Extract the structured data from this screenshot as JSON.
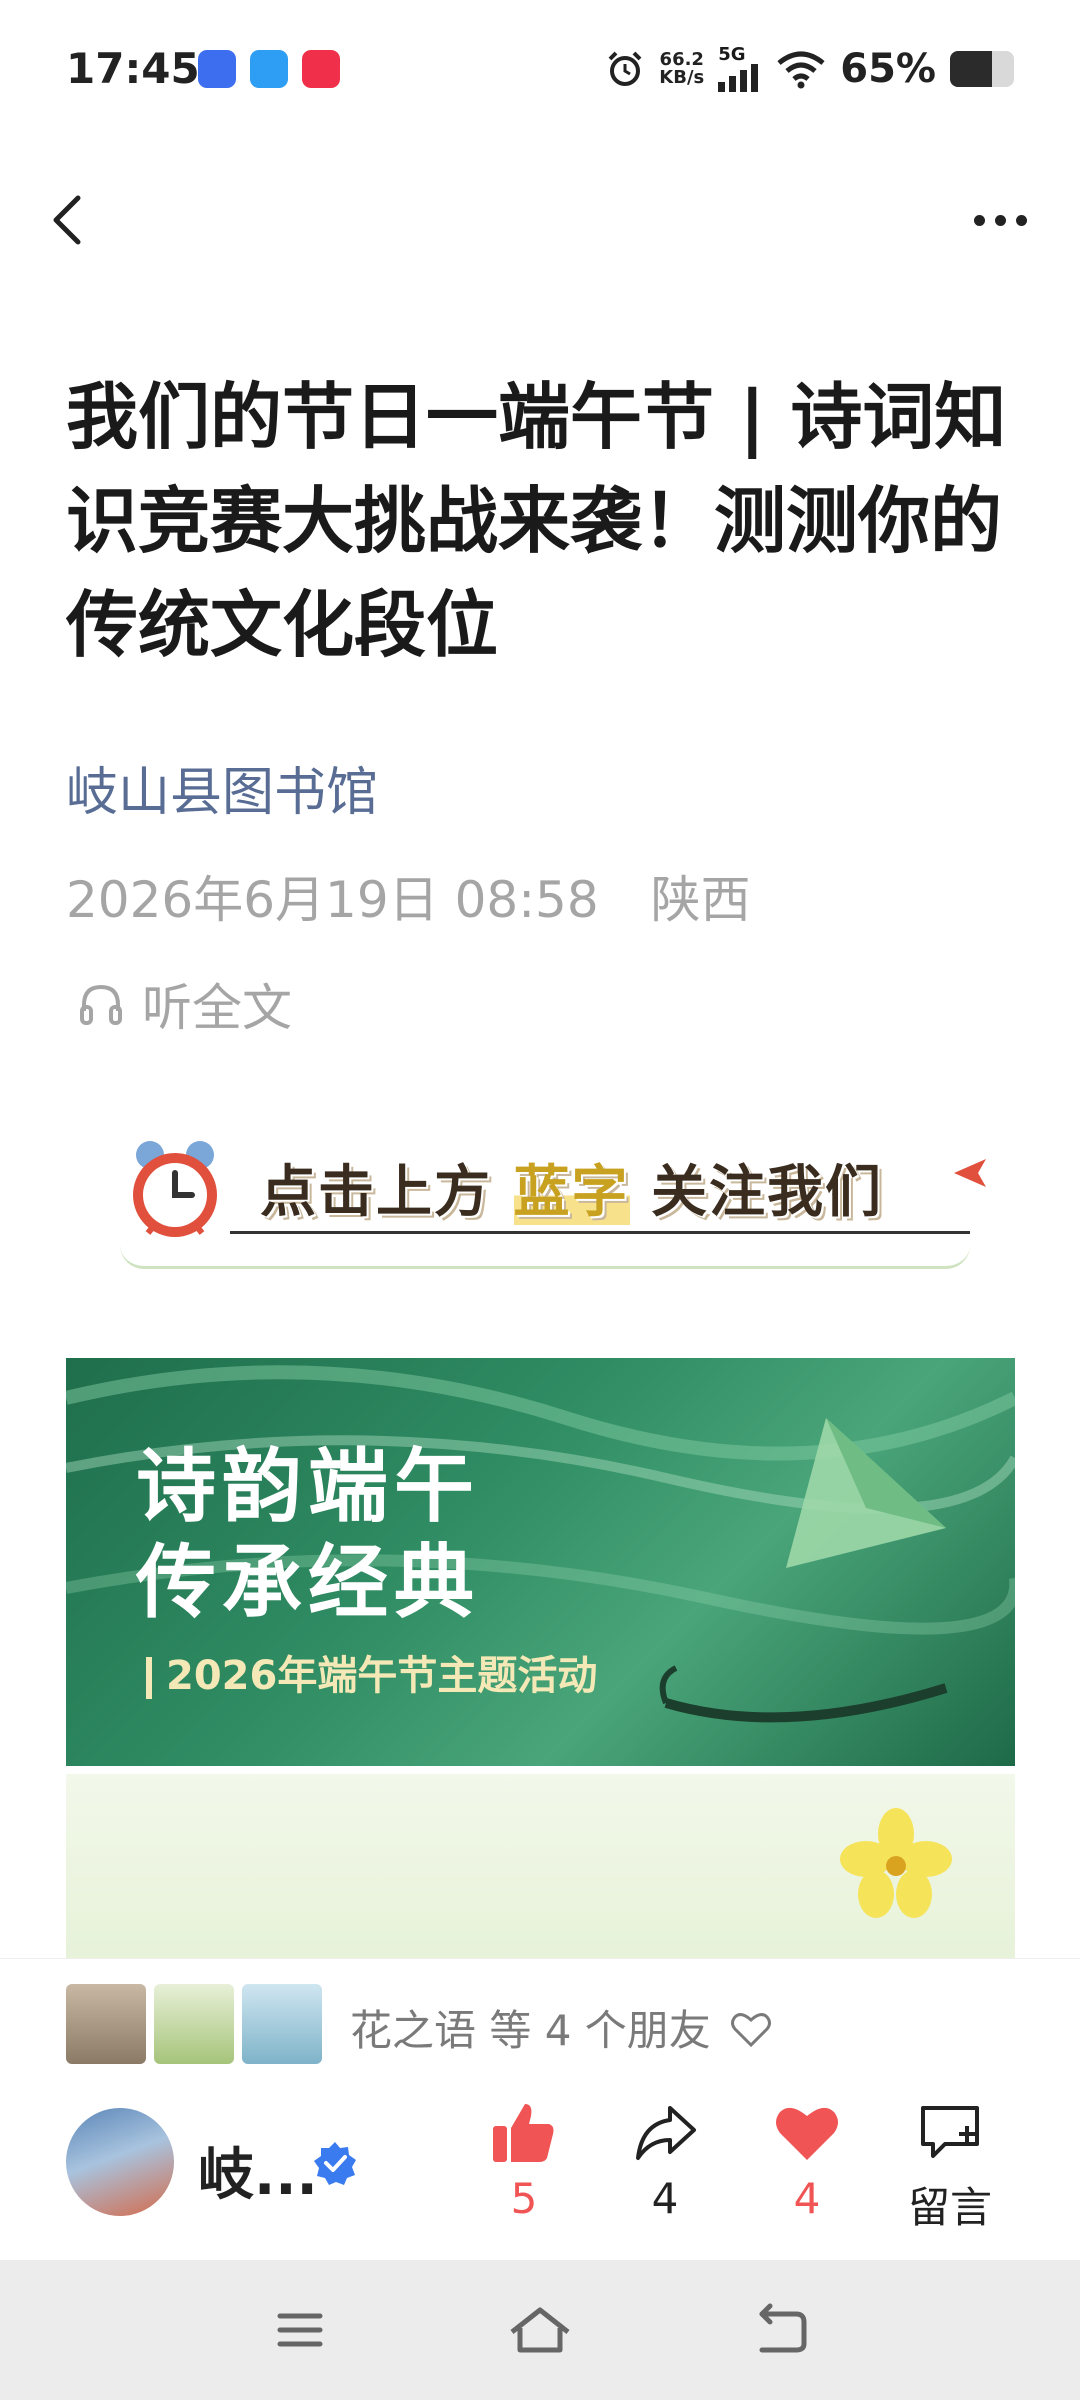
{
  "status_bar": {
    "time": "17:45",
    "net_speed_value": "66.2",
    "net_speed_unit": "KB/s",
    "network": "5G",
    "battery_percent_text": "65%",
    "battery_level": 0.65
  },
  "nav": {
    "back_icon": "chevron-left-icon",
    "more_icon": "more-dots-icon"
  },
  "article": {
    "title": "我们的节日一端午节 | 诗词知识竞赛大挑战来袭！测测你的传统文化段位",
    "author": "岐山县图书馆",
    "date": "2026年6月19日 08:58",
    "location": "陕西",
    "listen_label": "听全文"
  },
  "follow_banner": {
    "prefix": "点击上方",
    "highlight": "蓝字",
    "suffix": "关注我们"
  },
  "hero_image": {
    "title_line1": "诗韵端午",
    "title_line2": "传承经典",
    "subtitle": "2026年端午节主题活动"
  },
  "friends": {
    "text": "花之语 等 4 个朋友",
    "heart_icon": "heart-outline-icon"
  },
  "account": {
    "name": "岐..."
  },
  "actions": {
    "like_count": "5",
    "share_count": "4",
    "favorite_count": "4",
    "comment_label": "留言"
  },
  "colors": {
    "accent_red": "#f05454",
    "author_blue": "#586c94",
    "verified_blue": "#3a7bf0"
  }
}
